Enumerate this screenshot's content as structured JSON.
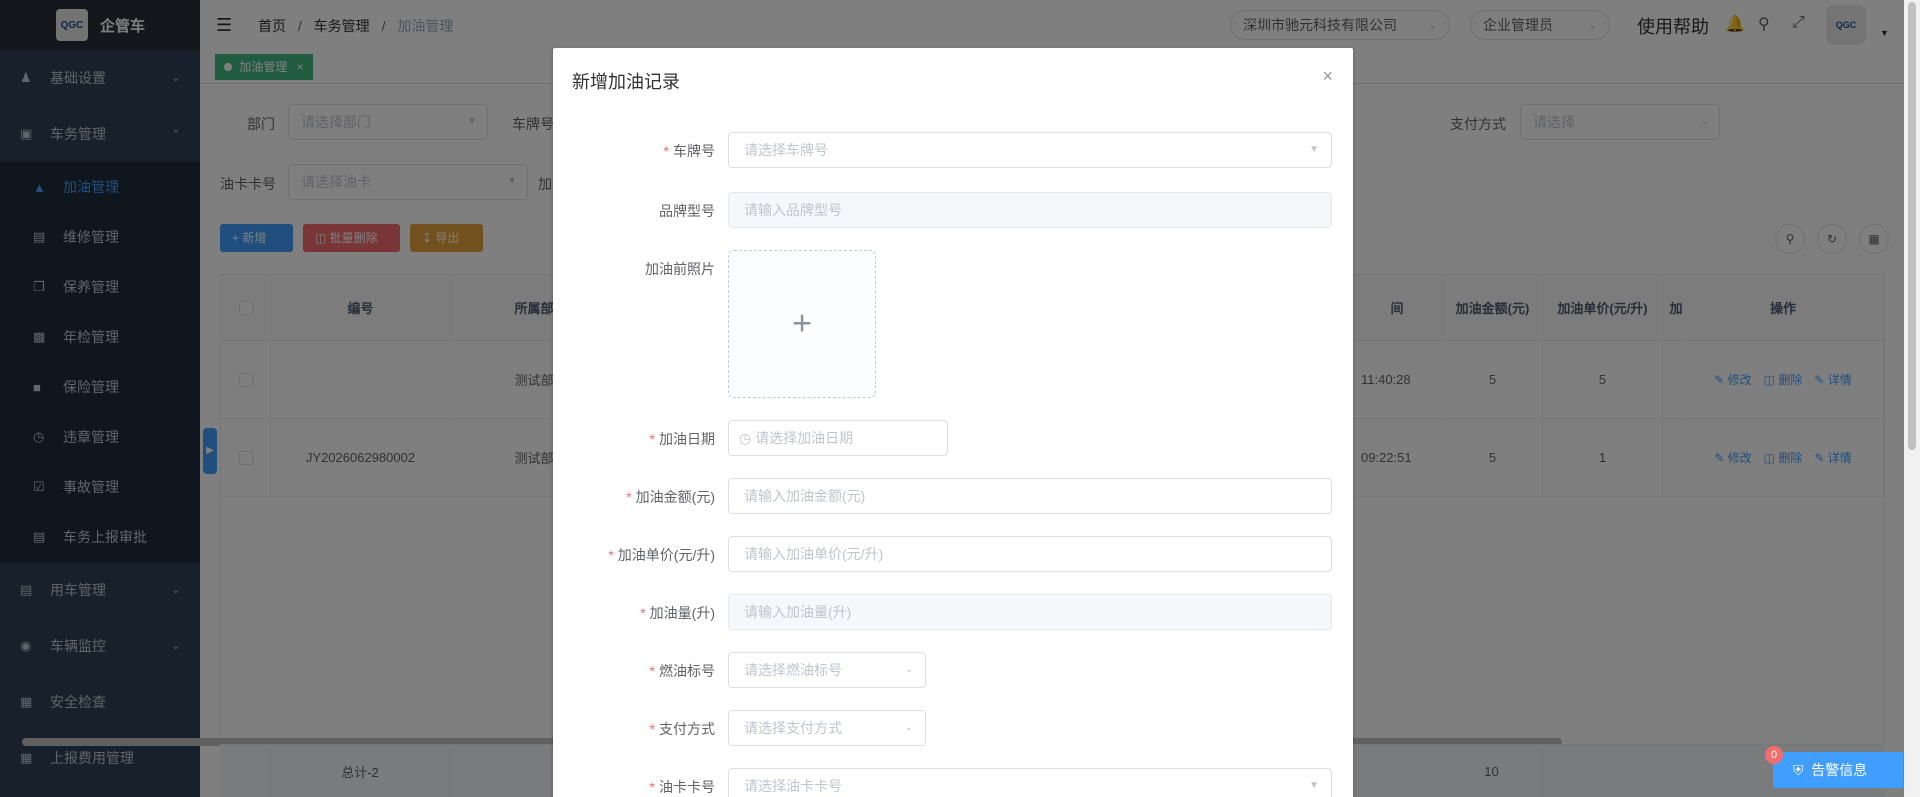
{
  "app": {
    "title": "企管车"
  },
  "sidebar": {
    "items": [
      {
        "label": "基础设置",
        "icon": "user-icon"
      },
      {
        "label": "车务管理",
        "icon": "monitor-icon"
      },
      {
        "label": "用车管理",
        "icon": "doc-icon"
      },
      {
        "label": "车辆监控",
        "icon": "globe-icon"
      },
      {
        "label": "安全检查",
        "icon": "calendar-icon"
      },
      {
        "label": "上报费用管理",
        "icon": "grid-icon"
      }
    ],
    "subitems": [
      {
        "label": "加油管理"
      },
      {
        "label": "维修管理"
      },
      {
        "label": "保养管理"
      },
      {
        "label": "年检管理"
      },
      {
        "label": "保险管理"
      },
      {
        "label": "违章管理"
      },
      {
        "label": "事故管理"
      },
      {
        "label": "车务上报审批"
      }
    ]
  },
  "navbar": {
    "breadcrumb": [
      "首页",
      "车务管理",
      "加油管理"
    ],
    "company": "深圳市驰元科技有限公司",
    "role": "企业管理员",
    "help": "使用帮助"
  },
  "tags": {
    "active": "加油管理"
  },
  "filters": {
    "dept_label": "部门",
    "dept_placeholder": "请选择部门",
    "plate_label": "车牌号",
    "pay_label": "支付方式",
    "pay_placeholder": "请选择",
    "card_label": "油卡卡号",
    "card_placeholder": "请选择油卡",
    "extra_label": "加"
  },
  "toolbar": {
    "add": "新增",
    "batch_delete": "批量删除",
    "export": "导出"
  },
  "table": {
    "headers": {
      "no": "编号",
      "dept": "所属部门",
      "time": "间",
      "amount": "加油金额(元)",
      "price": "加油单价(元/升)",
      "qty": "加油",
      "ops": "操作"
    },
    "rows": [
      {
        "no": "",
        "dept": "测试部门",
        "time": "11:40:28",
        "amount": "5",
        "price": "5"
      },
      {
        "no": "JY2026062980002",
        "dept": "测试部门",
        "time": "09:22:51",
        "amount": "5",
        "price": "1"
      }
    ],
    "ops": {
      "edit": "修改",
      "delete": "删除",
      "detail": "详情"
    },
    "summary": {
      "label": "总计-2",
      "amount": "10"
    }
  },
  "dialog": {
    "title": "新增加油记录",
    "fields": [
      {
        "label": "车牌号",
        "required": true,
        "placeholder": "请选择车牌号"
      },
      {
        "label": "品牌型号",
        "required": false,
        "placeholder": "请输入品牌型号"
      },
      {
        "label": "加油前照片",
        "required": false
      },
      {
        "label": "加油日期",
        "required": true,
        "placeholder": "请选择加油日期"
      },
      {
        "label": "加油金额(元)",
        "required": true,
        "placeholder": "请输入加油金额(元)"
      },
      {
        "label": "加油单价(元/升)",
        "required": true,
        "placeholder": "请输入加油单价(元/升)"
      },
      {
        "label": "加油量(升)",
        "required": true,
        "placeholder": "请输入加油量(升)"
      },
      {
        "label": "燃油标号",
        "required": true,
        "placeholder": "请选择燃油标号"
      },
      {
        "label": "支付方式",
        "required": true,
        "placeholder": "请选择支付方式"
      },
      {
        "label": "油卡卡号",
        "required": true,
        "placeholder": "请选择油卡卡号"
      }
    ]
  },
  "alarm": {
    "label": "告警信息",
    "count": "0"
  },
  "colors": {
    "sidebar": "#304156",
    "primary": "#409eff",
    "danger": "#f56c6c",
    "warning": "#e6a23c",
    "tag": "#42b983"
  }
}
